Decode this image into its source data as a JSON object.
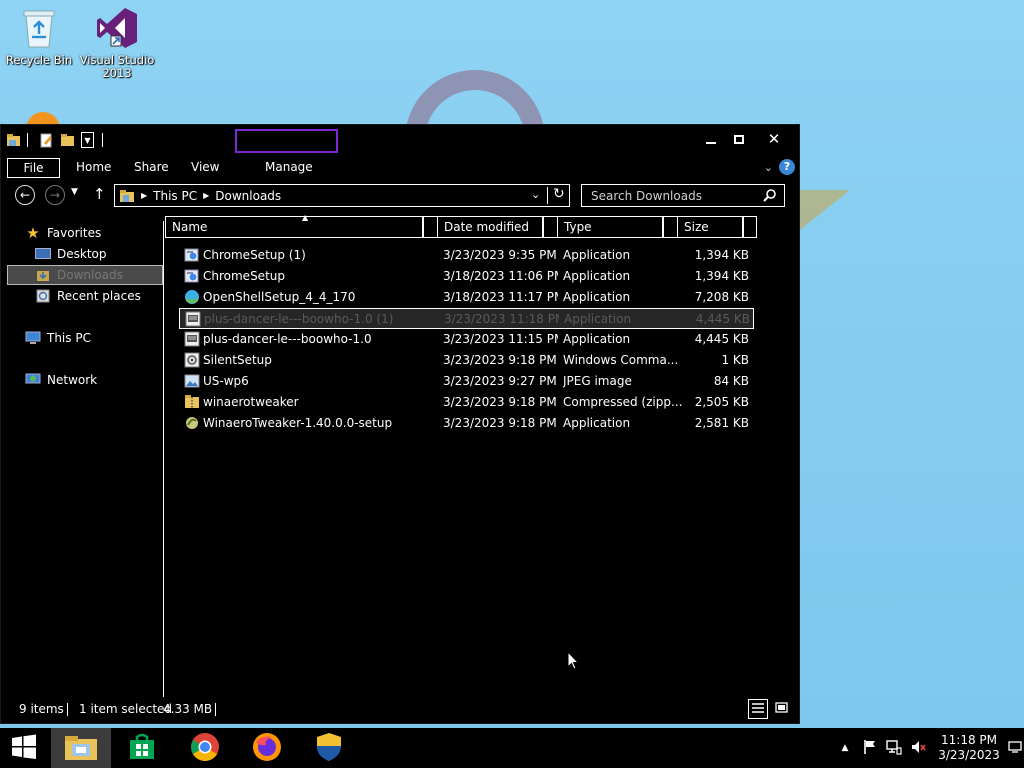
{
  "desktop": {
    "icons": [
      {
        "label": "Recycle Bin"
      },
      {
        "label": "Visual Studio 2013"
      }
    ]
  },
  "window": {
    "ribbon": {
      "tabs": [
        "File",
        "Home",
        "Share",
        "View",
        "Manage"
      ]
    },
    "address": {
      "segments": [
        "This PC",
        "Downloads"
      ]
    },
    "search": {
      "placeholder": "Search Downloads"
    },
    "nav": {
      "favorites": "Favorites",
      "desktop": "Desktop",
      "downloads": "Downloads",
      "recent": "Recent places",
      "this_pc": "This PC",
      "network": "Network"
    },
    "columns": {
      "name": "Name",
      "date": "Date modified",
      "type": "Type",
      "size": "Size"
    },
    "files": [
      {
        "name": "ChromeSetup (1)",
        "date": "3/23/2023 9:35 PM",
        "type": "Application",
        "size": "1,394 KB"
      },
      {
        "name": "ChromeSetup",
        "date": "3/18/2023 11:06 PM",
        "type": "Application",
        "size": "1,394 KB"
      },
      {
        "name": "OpenShellSetup_4_4_170",
        "date": "3/18/2023 11:17 PM",
        "type": "Application",
        "size": "7,208 KB"
      },
      {
        "name": "plus-dancer-le---boowho-1.0 (1)",
        "date": "3/23/2023 11:18 PM",
        "type": "Application",
        "size": "4,445 KB"
      },
      {
        "name": "plus-dancer-le---boowho-1.0",
        "date": "3/23/2023 11:15 PM",
        "type": "Application",
        "size": "4,445 KB"
      },
      {
        "name": "SilentSetup",
        "date": "3/23/2023 9:18 PM",
        "type": "Windows Comma...",
        "size": "1 KB"
      },
      {
        "name": "US-wp6",
        "date": "3/23/2023 9:27 PM",
        "type": "JPEG image",
        "size": "84 KB"
      },
      {
        "name": "winaerotweaker",
        "date": "3/23/2023 9:18 PM",
        "type": "Compressed (zipp...",
        "size": "2,505 KB"
      },
      {
        "name": "WinaeroTweaker-1.40.0.0-setup",
        "date": "3/23/2023 9:18 PM",
        "type": "Application",
        "size": "2,581 KB"
      }
    ],
    "status": {
      "count": "9 items",
      "selection": "1 item selected",
      "size": "4.33 MB"
    }
  },
  "taskbar": {
    "clock_time": "11:18 PM",
    "clock_date": "3/23/2023"
  }
}
